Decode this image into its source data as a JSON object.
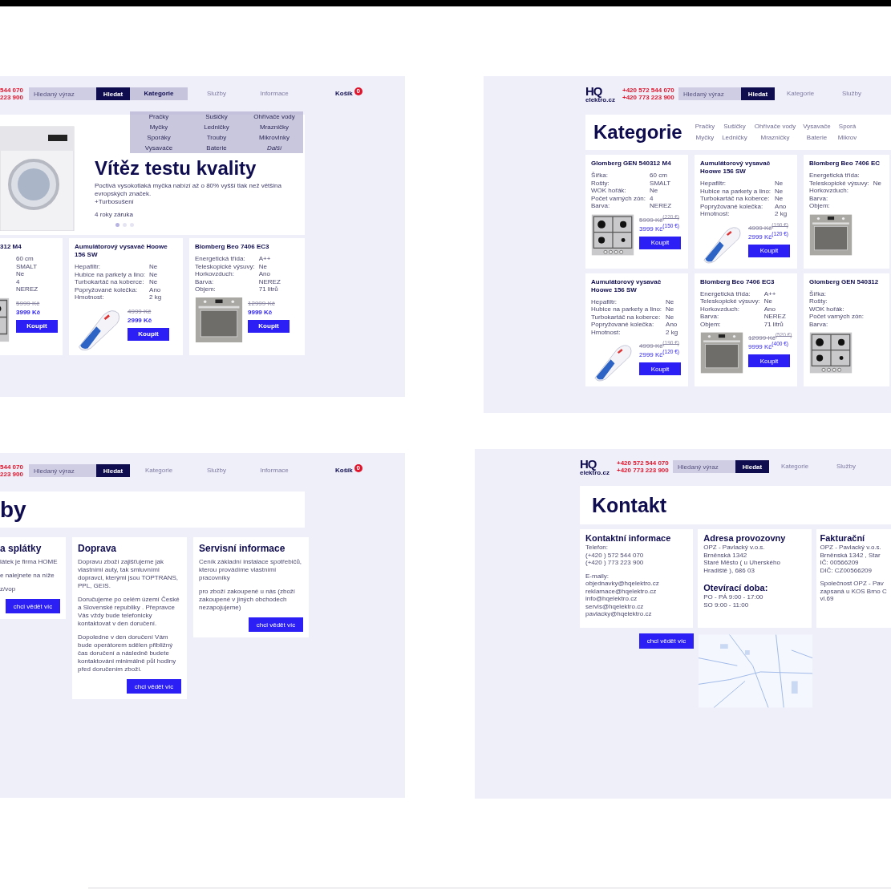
{
  "home_page": {
    "header": {
      "phones": [
        "544 070",
        "223 900"
      ],
      "search": {
        "placeholder": "Hledaný výraz"
      },
      "search_button": "Hledat",
      "nav": [
        {
          "label": "Kategorie",
          "selected": true
        },
        {
          "label": "Služby",
          "selected": false
        },
        {
          "label": "Informace",
          "selected": false
        }
      ],
      "cart": {
        "label": "Košík",
        "count": "0"
      }
    },
    "dropdown": [
      {
        "label": "Pračky",
        "kind": "link"
      },
      {
        "label": "Sušičky",
        "kind": "link"
      },
      {
        "label": "Ohřívače vody",
        "kind": "link"
      },
      {
        "label": "Myčky",
        "kind": "link"
      },
      {
        "label": "Ledničky",
        "kind": "link"
      },
      {
        "label": "Mrazničky",
        "kind": "link"
      },
      {
        "label": "Sporáky",
        "kind": "link"
      },
      {
        "label": "Trouby",
        "kind": "link"
      },
      {
        "label": "Mikrovlnky",
        "kind": "link"
      },
      {
        "label": "Vysavače",
        "kind": "link"
      },
      {
        "label": "Baterie",
        "kind": "link"
      },
      {
        "label": "Další",
        "kind": "more"
      }
    ],
    "hero": {
      "title": "Vítěz testu kvality",
      "text": "Poctivá vysokotlaká myčka nabízí až o 80% vyšší tlak než většina evropských značek.",
      "extra": "+Turbosušení",
      "note": "4 roky záruka",
      "dots": [
        {
          "selected": true
        },
        {
          "selected": false
        },
        {
          "selected": false
        }
      ]
    },
    "products": [
      {
        "kind": "stove",
        "title": "312 M4",
        "specs": [
          {
            "value": "60 cm"
          },
          {
            "value": "SMALT"
          },
          {
            "value": "Ne"
          },
          {
            "value": "4"
          },
          {
            "value": "NEREZ"
          }
        ],
        "old_price": "5999 Kč",
        "price": "3999 Kč",
        "button": "Koupit"
      },
      {
        "kind": "vacuum",
        "title": "Aumulátorový vysavač Hoowe 156 SW",
        "specs": [
          {
            "label": "Hepafiltr:",
            "value": "Ne"
          },
          {
            "label": "Hubice na parkety a lino:",
            "value": "Ne"
          },
          {
            "label": "Turbokartáč na koberce:",
            "value": "Ne"
          },
          {
            "label": "Popryžované kolečka:",
            "value": "Ano"
          },
          {
            "label": "Hmotnost:",
            "value": "2 kg"
          }
        ],
        "old_price": "4999 Kč",
        "price": "2999 Kč",
        "button": "Koupit"
      },
      {
        "kind": "oven",
        "title": "Blomberg Beo 7406 EC3",
        "specs": [
          {
            "label": "Energetická třída:",
            "value": "A++"
          },
          {
            "label": "Teleskopické výsuvy:",
            "value": "Ne"
          },
          {
            "label": "Horkovzduch:",
            "value": "Ano"
          },
          {
            "label": "Barva:",
            "value": "NEREZ"
          },
          {
            "label": "Objem:",
            "value": "71 litrů"
          }
        ],
        "old_price": "12999 Kč",
        "price": "9999 Kč",
        "button": "Koupit"
      }
    ]
  },
  "category_page": {
    "header": {
      "logo": {
        "mark": "HQ",
        "text": "elektro.cz"
      },
      "phones": [
        "+420 572 544 070",
        "+420 773 223 900"
      ],
      "search": {
        "placeholder": "Hledaný výraz"
      },
      "search_button": "Hledat",
      "nav": [
        {
          "label": "Kategorie",
          "selected": false
        },
        {
          "label": "Služby",
          "selected": false
        }
      ]
    },
    "title": "Kategorie",
    "categories": [
      "Pračky",
      "Myčky",
      "Sušičky",
      "Ledničky",
      "Ohřívače vody",
      "Mrazničky",
      "Vysavače",
      "Baterie",
      "Sporá",
      "Mikrov"
    ],
    "products": [
      {
        "kind": "stove",
        "title": "Glomberg GEN 540312 M4",
        "specs": [
          {
            "label": "Šířka:",
            "value": "60 cm"
          },
          {
            "label": "Rošty:",
            "value": "SMALT"
          },
          {
            "label": "WOK hořák:",
            "value": "Ne"
          },
          {
            "label": "Počet varných zón:",
            "value": "4"
          },
          {
            "label": "Barva:",
            "value": "NEREZ"
          }
        ],
        "old_price": "5999 Kč$^{(220 €)}$",
        "price": "3999 Kč$^{(150 €)}$",
        "button": "Koupit"
      },
      {
        "kind": "vacuum",
        "title": "Aumulátorový vysavač Hoowe 156 SW",
        "specs": [
          {
            "label": "Hepafiltr:",
            "value": "Ne"
          },
          {
            "label": "Hubice na parkety a lino:",
            "value": "Ne"
          },
          {
            "label": "Turbokartáč na koberce:",
            "value": "Ne"
          },
          {
            "label": "Popryžované kolečka:",
            "value": "Ano"
          },
          {
            "label": "Hmotnost:",
            "value": "2 kg"
          }
        ],
        "old_price": "4999 Kč$^{(190 €)}$",
        "price": "2999 Kč$^{(120 €)}$",
        "button": "Koupit"
      },
      {
        "kind": "oven",
        "title": "Blomberg Beo 7406 EC",
        "specs": [
          {
            "label": "Energetická třída:"
          },
          {
            "label": "Teleskopické výsuvy:",
            "value": "Ne"
          },
          {
            "label": "Horkovzduch:"
          },
          {
            "label": "Barva:"
          },
          {
            "label": "Objem:"
          }
        ]
      },
      {
        "kind": "vacuum",
        "title": "Aumulátorový vysavač Hoowe 156 SW",
        "specs": [
          {
            "label": "Hepafiltr:",
            "value": "Ne"
          },
          {
            "label": "Hubice na parkety a lino:",
            "value": "Ne"
          },
          {
            "label": "Turbokartáč na koberce:",
            "value": "Ne"
          },
          {
            "label": "Popryžované kolečka:",
            "value": "Ano"
          },
          {
            "label": "Hmotnost:",
            "value": "2 kg"
          }
        ],
        "old_price": "4999 Kč$^{(190 €)}$",
        "price": "2999 Kč$^{(120 €)}$",
        "button": "Koupit"
      },
      {
        "kind": "oven",
        "title": "Blomberg Beo 7406 EC3",
        "specs": [
          {
            "label": "Energetická třída:",
            "value": "A++"
          },
          {
            "label": "Teleskopické výsuvy:",
            "value": "Ne"
          },
          {
            "label": "Horkovzduch:",
            "value": "Ano"
          },
          {
            "label": "Barva:",
            "value": "NEREZ"
          },
          {
            "label": "Objem:",
            "value": "71 litrů"
          }
        ],
        "old_price": "12999 Kč$^{(520 €)}$",
        "price": "9999 Kč$^{(400 €)}$",
        "button": "Koupit"
      },
      {
        "kind": "stove",
        "title": "Glomberg GEN 540312",
        "specs": [
          {
            "label": "Šířka:"
          },
          {
            "label": "Rošty:"
          },
          {
            "label": "WOK hořák:"
          },
          {
            "label": "Počet varných zón:"
          },
          {
            "label": "Barva:"
          }
        ]
      }
    ]
  },
  "services_page": {
    "header": {
      "phones": [
        "544 070",
        "223 900"
      ],
      "search": {
        "placeholder": "Hledaný výraz"
      },
      "search_button": "Hledat",
      "nav": [
        {
          "label": "Kategorie",
          "selected": false
        },
        {
          "label": "Služby",
          "selected": false
        },
        {
          "label": "Informace",
          "selected": false
        }
      ],
      "cart": {
        "label": "Košík",
        "count": "0"
      }
    },
    "title": "by",
    "cards": [
      {
        "title": "a splátky",
        "paragraphs": [
          "látek je firma HOME",
          "e nalejnete na níže",
          "z/vop"
        ],
        "button": "chci vědět víc"
      },
      {
        "title": "Doprava",
        "paragraphs": [
          "Dopravu zboží zajišťujeme jak vlastními auty, tak smluvními dopravci, kterými jsou TOPTRANS, PPL, GEIS.",
          "Doručujeme po celém území České a Slovenské republiky . Přepravce Vás vždy bude telefonicky kontaktovat v den doručení.",
          "Dopoledne v den doručení Vám bude operátorem sdělen přibližný čas doručení a následně budete kontaktováni minimálně půl hodiny před doručením zboží."
        ],
        "button": "chci vědět víc"
      },
      {
        "title": "Servisní informace",
        "paragraphs": [
          "Ceník základní instalace spotřebičů, kterou provádíme vlastními pracovníky",
          "pro zboží zakoupené u nás (zboží zakoupené v jiných obchodech nezapojujeme)"
        ],
        "button": "chci vědět víc"
      }
    ]
  },
  "contact_page": {
    "header": {
      "logo": {
        "mark": "HQ",
        "text": "elektro.cz"
      },
      "phones": [
        "+420 572 544 070",
        "+420 773 223 900"
      ],
      "search": {
        "placeholder": "Hledaný výraz"
      },
      "search_button": "Hledat",
      "nav": [
        {
          "label": "Kategorie",
          "selected": false
        },
        {
          "label": "Služby",
          "selected": false
        }
      ]
    },
    "title": "Kontakt",
    "cards": [
      {
        "blocks": [
          {
            "heading": "Kontaktní informace",
            "lines": [
              "Telefon:",
              "(+420 ) 572 544 070",
              "(+420 ) 773 223 900"
            ]
          },
          {
            "lines": [
              "E-maily:",
              "objednavky@hqelektro.cz",
              "reklamace@hqelektro.cz",
              "info@hqelektro.cz",
              "servis@hqelektro.cz",
              "pavlacky@hqelektro.cz"
            ]
          }
        ]
      },
      {
        "blocks": [
          {
            "heading": "Adresa provozovny",
            "lines": [
              "OPZ - Pavlacký  v.o.s.",
              "Brněnská 1342",
              "Staré Město ( u Uherského Hradiště ), 686 03"
            ]
          },
          {
            "heading": "Otevírací doba:",
            "lines": [
              "PO - PÁ 9:00 - 17:00",
              "SO  9:00 - 11:00"
            ]
          }
        ]
      },
      {
        "blocks": [
          {
            "heading": "Fakturační",
            "lines": [
              "OPZ - Pavlacký v.o.s.",
              "Brněnská 1342 , Star",
              "IČ: 00566209",
              "DIČ: CZ00566209"
            ]
          },
          {
            "lines": [
              "Společnost OPZ - Pav",
              "zapsaná u KOS Brno C",
              "vl.69"
            ]
          }
        ]
      }
    ],
    "button": "chci vědět víc"
  }
}
